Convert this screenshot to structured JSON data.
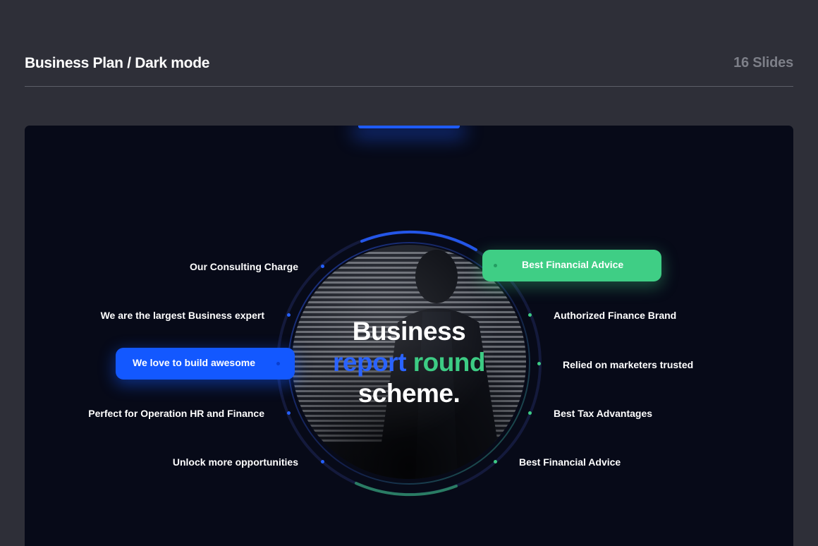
{
  "header": {
    "title": "Business Plan / Dark mode",
    "slide_count": "16 Slides"
  },
  "slide": {
    "headline": {
      "line1": "Business",
      "line2_part1": "report",
      "line2_part2": "round",
      "line3": "scheme."
    },
    "left_labels": [
      "Our Consulting Charge",
      "We are the largest Business expert",
      "We love to build awesome",
      "Perfect for Operation HR and Finance",
      "Unlock more opportunities"
    ],
    "right_labels": [
      "Best Financial Advice",
      "Authorized Finance Brand",
      "Relied on marketers trusted",
      "Best Tax Advantages",
      "Best Financial Advice"
    ],
    "highlighted": {
      "left_index": 2,
      "right_index": 0
    },
    "colors": {
      "accent_blue": "#1358ff",
      "accent_green": "#3fce85",
      "slide_background": "#070a18",
      "page_background": "#2e2f38"
    }
  }
}
